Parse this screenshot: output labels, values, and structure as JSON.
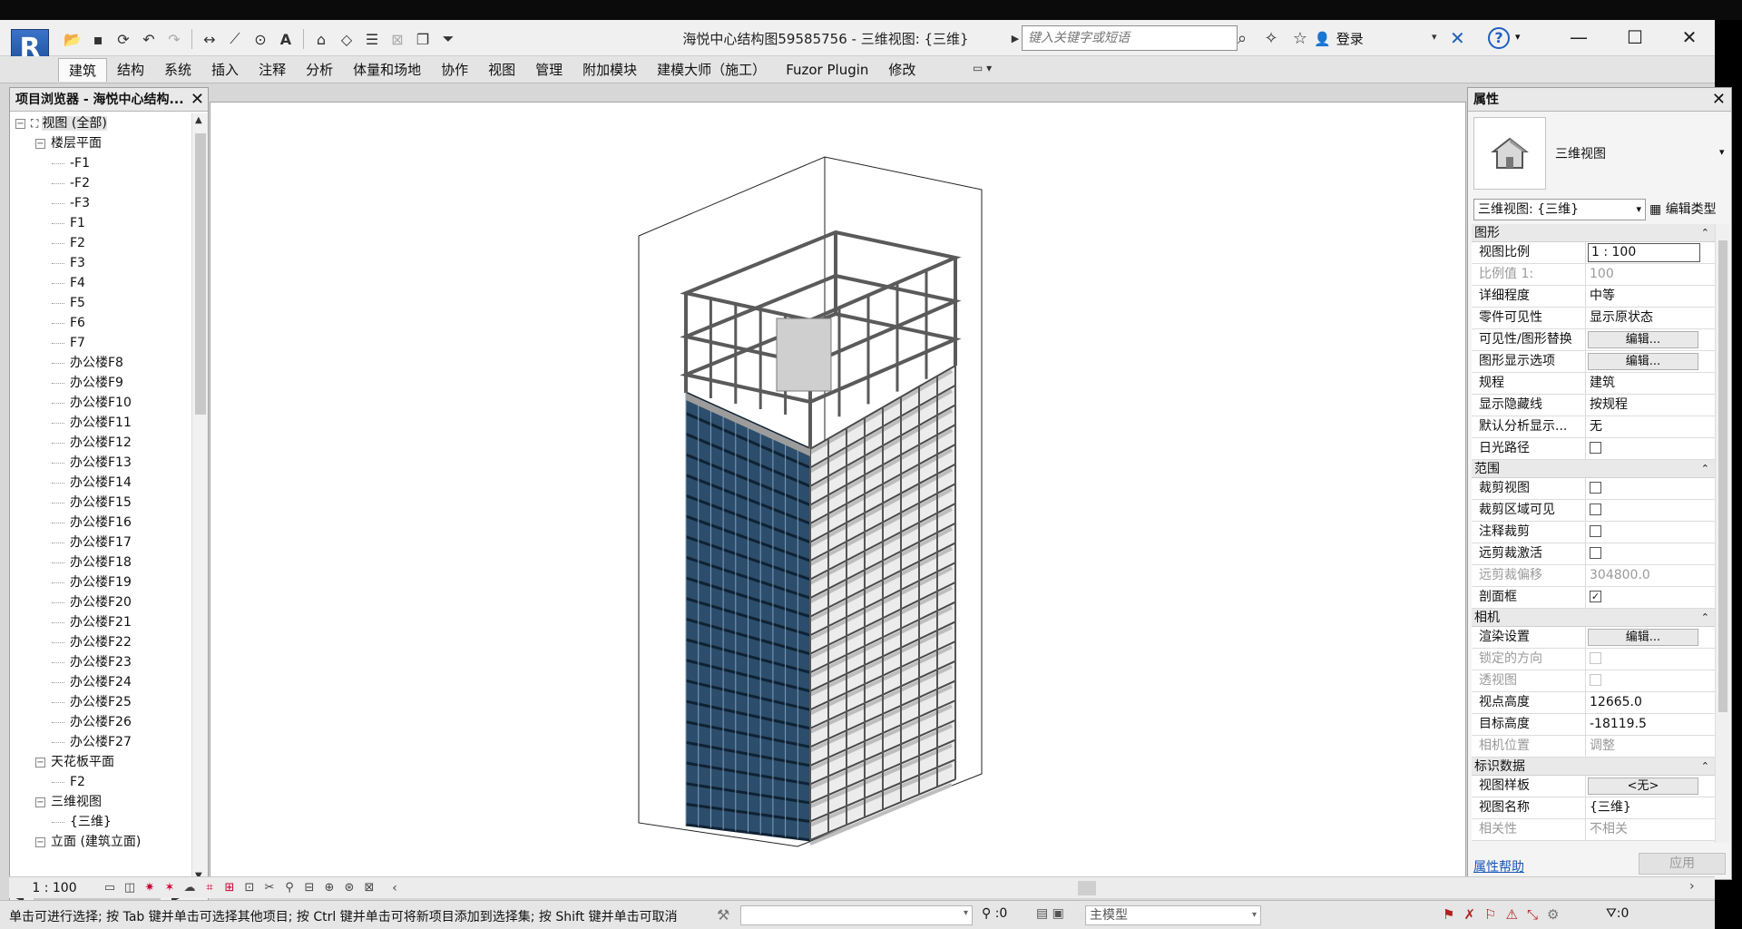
{
  "app": {
    "logo_letter": "R",
    "title": "海悦中心结构图59585756 - 三维视图: {三维}"
  },
  "search": {
    "placeholder": "键入关键字或短语"
  },
  "user": {
    "login_label": "登录"
  },
  "ribbon": {
    "tabs": [
      "建筑",
      "结构",
      "系统",
      "插入",
      "注释",
      "分析",
      "体量和场地",
      "协作",
      "视图",
      "管理",
      "附加模块",
      "建模大师（施工）",
      "Fuzor Plugin",
      "修改"
    ],
    "active_tab": "建筑"
  },
  "browser": {
    "title": "项目浏览器 - 海悦中心结构...",
    "tree": [
      {
        "level": 0,
        "toggle": "−",
        "label": "视图 (全部)",
        "selected": true,
        "icon": "views-icon"
      },
      {
        "level": 1,
        "toggle": "−",
        "label": "楼层平面"
      },
      {
        "level": 2,
        "label": "-F1"
      },
      {
        "level": 2,
        "label": "-F2"
      },
      {
        "level": 2,
        "label": "-F3"
      },
      {
        "level": 2,
        "label": "F1"
      },
      {
        "level": 2,
        "label": "F2"
      },
      {
        "level": 2,
        "label": "F3"
      },
      {
        "level": 2,
        "label": "F4"
      },
      {
        "level": 2,
        "label": "F5"
      },
      {
        "level": 2,
        "label": "F6"
      },
      {
        "level": 2,
        "label": "F7"
      },
      {
        "level": 2,
        "label": "办公楼F8"
      },
      {
        "level": 2,
        "label": "办公楼F9"
      },
      {
        "level": 2,
        "label": "办公楼F10"
      },
      {
        "level": 2,
        "label": "办公楼F11"
      },
      {
        "level": 2,
        "label": "办公楼F12"
      },
      {
        "level": 2,
        "label": "办公楼F13"
      },
      {
        "level": 2,
        "label": "办公楼F14"
      },
      {
        "level": 2,
        "label": "办公楼F15"
      },
      {
        "level": 2,
        "label": "办公楼F16"
      },
      {
        "level": 2,
        "label": "办公楼F17"
      },
      {
        "level": 2,
        "label": "办公楼F18"
      },
      {
        "level": 2,
        "label": "办公楼F19"
      },
      {
        "level": 2,
        "label": "办公楼F20"
      },
      {
        "level": 2,
        "label": "办公楼F21"
      },
      {
        "level": 2,
        "label": "办公楼F22"
      },
      {
        "level": 2,
        "label": "办公楼F23"
      },
      {
        "level": 2,
        "label": "办公楼F24"
      },
      {
        "level": 2,
        "label": "办公楼F25"
      },
      {
        "level": 2,
        "label": "办公楼F26"
      },
      {
        "level": 2,
        "label": "办公楼F27"
      },
      {
        "level": 1,
        "toggle": "−",
        "label": "天花板平面"
      },
      {
        "level": 2,
        "label": "F2"
      },
      {
        "level": 1,
        "toggle": "−",
        "label": "三维视图"
      },
      {
        "level": 2,
        "label": "{三维}"
      },
      {
        "level": 1,
        "toggle": "−",
        "label": "立面 (建筑立面)"
      }
    ]
  },
  "properties": {
    "title": "属性",
    "type_name": "三维视图",
    "instance_select": "三维视图: {三维}",
    "edit_type_label": "编辑类型",
    "groups": [
      {
        "name": "图形",
        "rows": [
          {
            "name": "视图比例",
            "value": "1 : 100",
            "kind": "input"
          },
          {
            "name": "比例值 1:",
            "value": "100",
            "dim": true
          },
          {
            "name": "详细程度",
            "value": "中等"
          },
          {
            "name": "零件可见性",
            "value": "显示原状态"
          },
          {
            "name": "可见性/图形替换",
            "value": "编辑...",
            "kind": "button"
          },
          {
            "name": "图形显示选项",
            "value": "编辑...",
            "kind": "button"
          },
          {
            "name": "规程",
            "value": "建筑"
          },
          {
            "name": "显示隐藏线",
            "value": "按规程"
          },
          {
            "name": "默认分析显示...",
            "value": "无"
          },
          {
            "name": "日光路径",
            "value": "",
            "kind": "check",
            "checked": false
          }
        ]
      },
      {
        "name": "范围",
        "rows": [
          {
            "name": "裁剪视图",
            "value": "",
            "kind": "check",
            "checked": false
          },
          {
            "name": "裁剪区域可见",
            "value": "",
            "kind": "check",
            "checked": false
          },
          {
            "name": "注释裁剪",
            "value": "",
            "kind": "check",
            "checked": false
          },
          {
            "name": "远剪裁激活",
            "value": "",
            "kind": "check",
            "checked": false
          },
          {
            "name": "远剪裁偏移",
            "value": "304800.0",
            "dim": true
          },
          {
            "name": "剖面框",
            "value": "",
            "kind": "check",
            "checked": true
          }
        ]
      },
      {
        "name": "相机",
        "rows": [
          {
            "name": "渲染设置",
            "value": "编辑...",
            "kind": "button"
          },
          {
            "name": "锁定的方向",
            "value": "",
            "kind": "check",
            "checked": false,
            "dim": true
          },
          {
            "name": "透视图",
            "value": "",
            "kind": "check",
            "checked": false,
            "dim": true
          },
          {
            "name": "视点高度",
            "value": "12665.0"
          },
          {
            "name": "目标高度",
            "value": "-18119.5"
          },
          {
            "name": "相机位置",
            "value": "调整",
            "dim": true
          }
        ]
      },
      {
        "name": "标识数据",
        "rows": [
          {
            "name": "视图样板",
            "value": "<无>",
            "kind": "button"
          },
          {
            "name": "视图名称",
            "value": "{三维}"
          },
          {
            "name": "相关性",
            "value": "不相关",
            "dim": true
          }
        ]
      }
    ],
    "help_link": "属性帮助",
    "apply_label": "应用"
  },
  "viewbar": {
    "scale": "1 : 100"
  },
  "status": {
    "message": "单击可进行选择; 按 Tab 键并单击可选择其他项目; 按 Ctrl 键并单击可将新项目添加到选择集; 按 Shift 键并单击可取消",
    "selection_count": ":0",
    "model_select": "主模型",
    "filter_count": ":0"
  },
  "colors": {
    "glass": "#2c4d6b",
    "glass_dark": "#1c3449",
    "steel": "#5a5a5a",
    "slab": "#dcdcdc",
    "accent": "#1f5fbf"
  }
}
